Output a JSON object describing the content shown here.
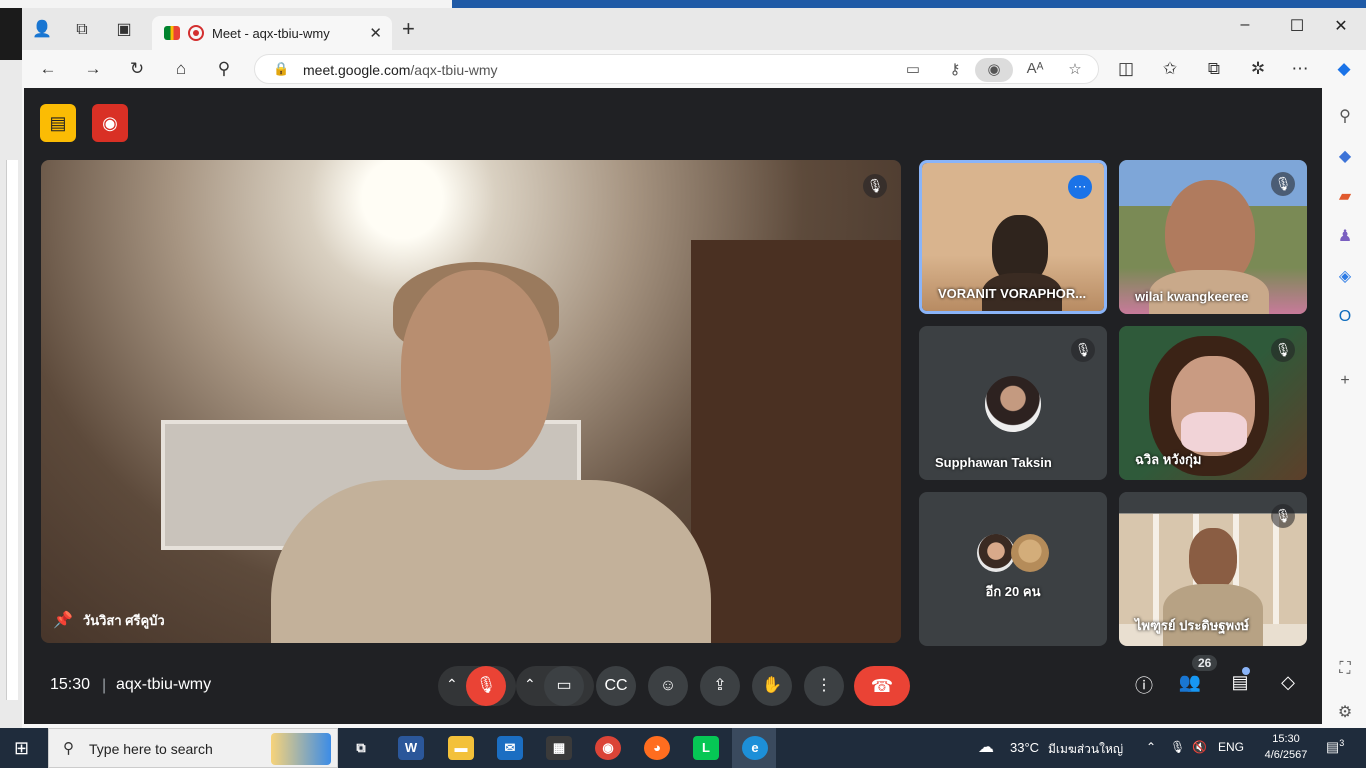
{
  "browser": {
    "tab_title": "Meet - aqx-tbiu-wmy",
    "tab_close": "✕",
    "new_tab": "+",
    "url_host": "meet.google.com",
    "url_path": "/aqx-tbiu-wmy",
    "window_controls": [
      "–",
      "☐",
      "✕"
    ]
  },
  "meet": {
    "main_participant": "วันวิสา ศรีคูบัว",
    "tiles": [
      {
        "name": "VORANIT VORAPHOR...",
        "type": "video",
        "active_speaker": true
      },
      {
        "name": "wilai kwangkeeree",
        "type": "video"
      },
      {
        "name": "Supphawan Taksin",
        "type": "avatar"
      },
      {
        "name": "ฉวิล หวังกุ่ม",
        "type": "video"
      },
      {
        "name": "อีก 20 คน",
        "type": "group"
      },
      {
        "name": "ไพฑูรย์ ประดิษฐพงษ์",
        "type": "video"
      }
    ],
    "time": "15:30",
    "separator": "|",
    "meeting_code": "aqx-tbiu-wmy",
    "participant_count": "26",
    "accent_red": "#ea4335",
    "active_blue": "#8ab4f8"
  },
  "taskbar": {
    "search_placeholder": "Type here to search",
    "weather": "33°C",
    "weather_desc": "มีเมฆส่วนใหญ่",
    "language": "ENG",
    "clock_time": "15:30",
    "clock_date": "4/6/2567",
    "notification_count": "3"
  }
}
